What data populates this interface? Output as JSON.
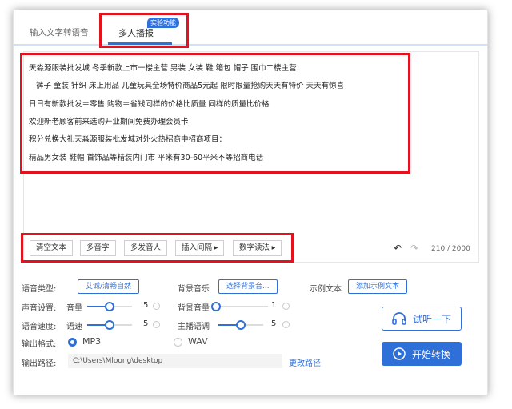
{
  "tabs": [
    {
      "label": "输入文字转语音"
    },
    {
      "label": "多人播报",
      "badge": "实验功能"
    }
  ],
  "editor": {
    "lines": [
      "天淼源服装批发城   冬季新款上市一楼主营   男装   女装   鞋   箱包   帽子   围巾二楼主营",
      "裤子   童装   针织   床上用品   儿童玩具全场特价商品5元起   限时限量抢购天天有特价   天天有惊喜",
      "日日有新款批发＝零售   购物＝省钱同样的价格比质量   同样的质量比价格",
      "欢迎新老顾客前来选购开业期间免费办理会员卡",
      "积分兑换大礼天淼源服装批发城对外火热招商中招商项目：",
      "精品男女装   鞋帽   首饰品等精装内门市   平米有30-60平米不等招商电话"
    ],
    "toolbar": {
      "clear": "清空文本",
      "polyphone": "多音字",
      "multi_speaker": "多发音人",
      "insert_pause": "插入间隔 ▸",
      "number_reading": "数字读法 ▸"
    },
    "counter": "210 / 2000"
  },
  "settings": {
    "voice_type_label": "语音类型:",
    "voice_type_value": "艾诚/清畅自然",
    "bg_music_label": "背景音乐",
    "bg_music_button": "选择背景音...",
    "sample_text_label": "示例文本",
    "sample_text_button": "添加示例文本",
    "sound_label": "声音设置:",
    "volume_label": "音量",
    "volume_value": "5",
    "volume_level": 0.5,
    "bg_volume_label": "背景音量",
    "bg_volume_value": "1",
    "bg_volume_level": 0.05,
    "speed_label": "语音速度:",
    "rate_label": "语速",
    "rate_value": "5",
    "rate_level": 0.5,
    "pitch_label": "主播语调",
    "pitch_value": "5",
    "pitch_level": 0.5,
    "format_label": "输出格式:",
    "format_mp3": "MP3",
    "format_wav": "WAV",
    "path_label": "输出路径:",
    "path_value": "C:\\Users\\Mloong\\desktop",
    "change_path": "更改路径"
  },
  "actions": {
    "listen": "试听一下",
    "convert": "开始转换"
  },
  "colors": {
    "accent": "#2f6fd8",
    "highlight": "#e4111e"
  }
}
